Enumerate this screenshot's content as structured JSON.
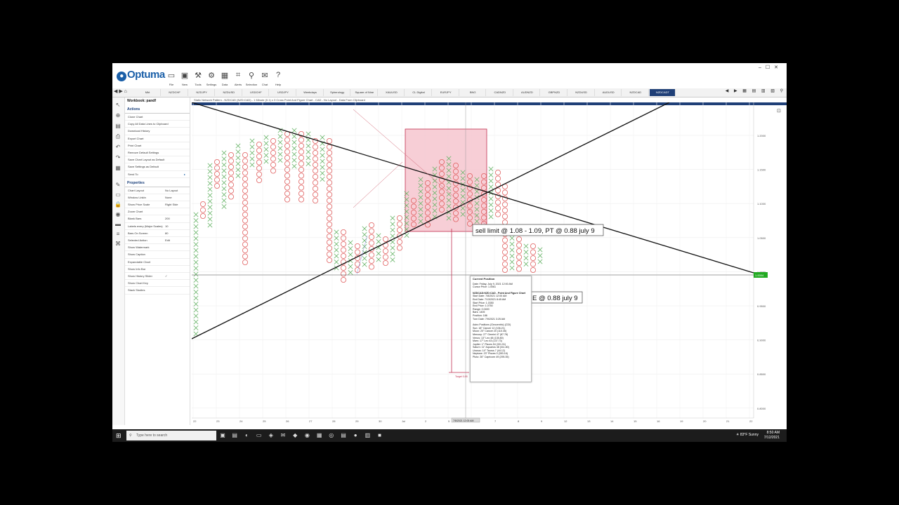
{
  "app": {
    "name": "Optuma"
  },
  "ribbon": {
    "buttons": [
      {
        "label": "File",
        "icon": "folder-icon"
      },
      {
        "label": "New",
        "icon": "new-icon"
      },
      {
        "label": "Tools",
        "icon": "tools-icon"
      },
      {
        "label": "Settings",
        "icon": "settings-icon"
      },
      {
        "label": "Data",
        "icon": "data-icon"
      },
      {
        "label": "Alerts",
        "icon": "alerts-icon"
      },
      {
        "label": "Selection",
        "icon": "selection-icon"
      },
      {
        "label": "Chat",
        "icon": "chat-icon"
      },
      {
        "label": "Help",
        "icon": "help-icon"
      }
    ]
  },
  "tabs": [
    "Mkt",
    "NZDCHF",
    "NZDJPY",
    "NZDUSD",
    "USDCHF",
    "USDJPY",
    "Weekdays",
    "Spherology",
    "Square of Nine",
    "XAUUSD",
    "CL Digital",
    "EURJPY",
    "BNG",
    "CADNZD",
    "AUDNZD",
    "GBPNZD",
    "NZDUSD",
    "AUDUSD",
    "NZDCAD",
    "NZDCADT"
  ],
  "active_tab_index": 19,
  "panel": {
    "workbook_title": "Workbook: pandf",
    "actions_title": "Actions",
    "actions": [
      "Clone Chart",
      "Copy All Data Lines to Clipboard",
      "Download History",
      "Export Chart",
      "Print Chart",
      "Remove Default Settings",
      "Save Chart Layout as Default",
      "Save Settings as Default",
      "Send To"
    ],
    "properties_title": "Properties",
    "properties": [
      {
        "label": "Chart Layout",
        "value": "No Layout"
      },
      {
        "label": "Window Linkin",
        "value": "None"
      },
      {
        "label": "Show Price Scale",
        "value": "Right Side"
      },
      {
        "label": "Zoom Chart",
        "value": ""
      },
      {
        "label": "Blank Bars",
        "value": "200"
      },
      {
        "label": "Labels every (Major Scales)",
        "value": "10"
      },
      {
        "label": "Bars On Screen",
        "value": "80"
      },
      {
        "label": "Selected Action",
        "value": "Edit"
      },
      {
        "label": "Show Watermark",
        "value": ""
      },
      {
        "label": "Show Caption",
        "value": ""
      },
      {
        "label": "Expandable Chart",
        "value": ""
      },
      {
        "label": "Show Info Bar",
        "value": ""
      },
      {
        "label": "Show History Slider",
        "value": "✓"
      },
      {
        "label": "Show Chart Key",
        "value": ""
      },
      {
        "label": "Stack Studies",
        "value": ""
      }
    ]
  },
  "chart": {
    "info_text": "Static Network Pattern - NZDCAD (NZD:CAD) - 1 Minute (0.1) x 3 Cross Point And Figure Chart - CAD - No Layout - Data From Clipboard",
    "price_labels": [
      "1.2000",
      "1.1500",
      "1.1000",
      "1.0500",
      "1.0000",
      "0.9500",
      "0.9000",
      "0.8500",
      "0.8000"
    ],
    "date_labels": [
      "22",
      "23",
      "24",
      "25",
      "26",
      "27",
      "28",
      "29",
      "30",
      "Jul",
      "2",
      "5",
      "6",
      "7",
      "8",
      "9",
      "12",
      "13",
      "14",
      "15",
      "16",
      "19",
      "20",
      "21",
      "22"
    ],
    "annotation_1": "sell limit @ 1.08 - 1.09, PT @ 0.88 july 9",
    "annotation_2": "E @ 0.88 july 9",
    "target_label": "Target 0.88",
    "current_price_tag": "1.0004",
    "crosshair_date": "7/8/2021 12:00 AM",
    "colors": {
      "x": "#6fb86f",
      "o": "#e06060",
      "rect": "#f6c6cf",
      "rect_border": "#c03050",
      "trend": "#111111",
      "price_tag": "#22aa22"
    }
  },
  "tooltip": {
    "title": "Current Position",
    "lines": [
      "Date: Friday, July 9, 2021 12:00 AM",
      "Cursor Price: 1.0061",
      "",
      "NZDCAD:NZD:CAD - Point And Figure Chart",
      "Start Date: 7/8/2021 12:00 AM",
      "End Date: 7/13/2021 8:45 AM",
      "Start Price: 1.0350",
      "End Price: 1.0750",
      "Range: 0.0400",
      "Bars: 1405",
      "Position: 186",
      "Turn Date: 7/9/2021 3:25 AM",
      "",
      "Astro Positions (Geocentric) (CDI)",
      "Sun: 18° Cancer 12 (106.21)",
      "Moon: 20° Cancer 20 (110.35)",
      "Mercury: 27° Gemini 47 (87.78)",
      "Venus: 13° Leo 48 (135.80)",
      "Mars: 17° Leo 43 (137.73)",
      "Jupiter: 1° Pisces 54 (331.91)",
      "Saturn: 11° Aquarius 48 (311.80)",
      "Uranus: 14° Taurus 7 (44.12)",
      "Neptune: 23° Pisces 0 (353.16)",
      "Pluto: 26° Capricorn 49 (295.35)"
    ]
  },
  "taskbar": {
    "search_placeholder": "Type here to search",
    "weather": "83°F Sunny",
    "time": "8:50 AM",
    "date": "7/12/2021"
  }
}
